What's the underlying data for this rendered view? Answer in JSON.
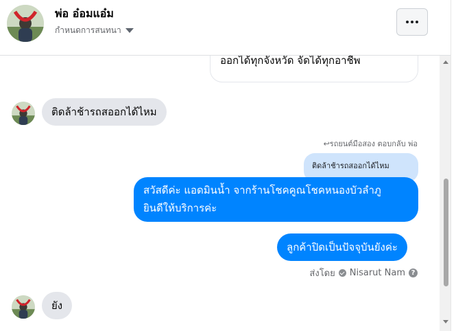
{
  "header": {
    "name": "พ่อ อ๋อมแอ๋ม",
    "subtitle": "กำหนดการสนทนา",
    "more_icon": "more-horizontal-icon"
  },
  "messages": {
    "top_partial": "ออกได้ทุกจังหวัด จัดได้ทุกอาชีพ",
    "incoming_1": "ติดล้าช้ารถสออกได้ไหม",
    "reply_label": "↩รถยนต์มือสอง ตอบกลับ พ่อ",
    "reply_quote": "ติดล้าช้ารถสออกได้ไหม",
    "outgoing_1_line1": "สวัสดีค่ะ แอดมินน้ำ จากร้านโชคคูณโชคหนองบัวลำภู",
    "outgoing_1_line2": "ยินดีให้บริการค่ะ",
    "outgoing_2": "ลูกค้าปิดเป็นปัจจุบันยังค่ะ",
    "sent_by_prefix": "ส่งโดย",
    "sent_by_name": "Nisarut Nam",
    "incoming_2": "ยัง"
  },
  "colors": {
    "outgoing_bubble": "#0084ff",
    "incoming_bubble": "#e4e6eb",
    "reply_quote_bg": "#cfe4fc"
  }
}
